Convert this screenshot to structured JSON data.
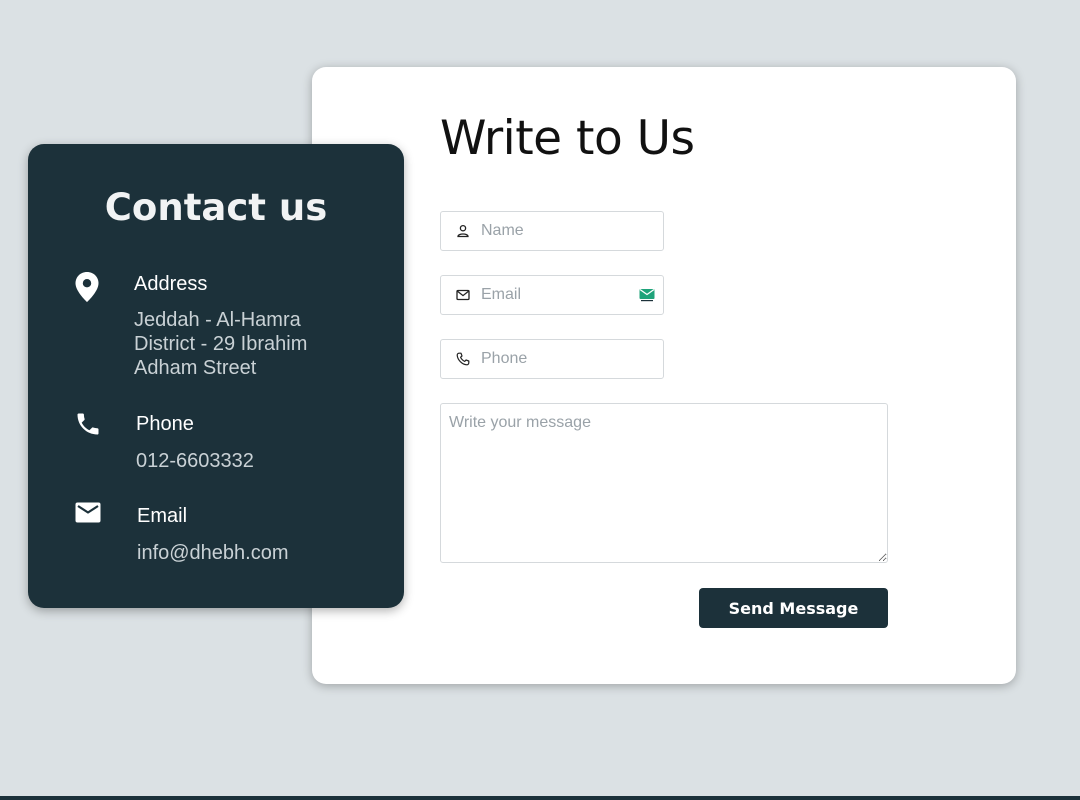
{
  "form": {
    "title": "Write to Us",
    "name_placeholder": "Name",
    "email_placeholder": "Email",
    "phone_placeholder": "Phone",
    "message_placeholder": "Write your message",
    "send_label": "Send Message"
  },
  "contact": {
    "title": "Contact us",
    "address": {
      "label": "Address",
      "line1": "Jeddah - Al-Hamra",
      "line2": "District - 29 Ibrahim",
      "line3": "Adham Street",
      "icon": "location-pin-icon"
    },
    "phone": {
      "label": "Phone",
      "value": "012-6603332",
      "icon": "phone-icon"
    },
    "email": {
      "label": "Email",
      "value": "info@dhebh.com",
      "icon": "mail-icon"
    }
  },
  "colors": {
    "dark_card": "#1c313a",
    "background": "#dbe1e4",
    "card": "#ffffff",
    "button": "#1c313a",
    "badge": "#1fa37a"
  }
}
